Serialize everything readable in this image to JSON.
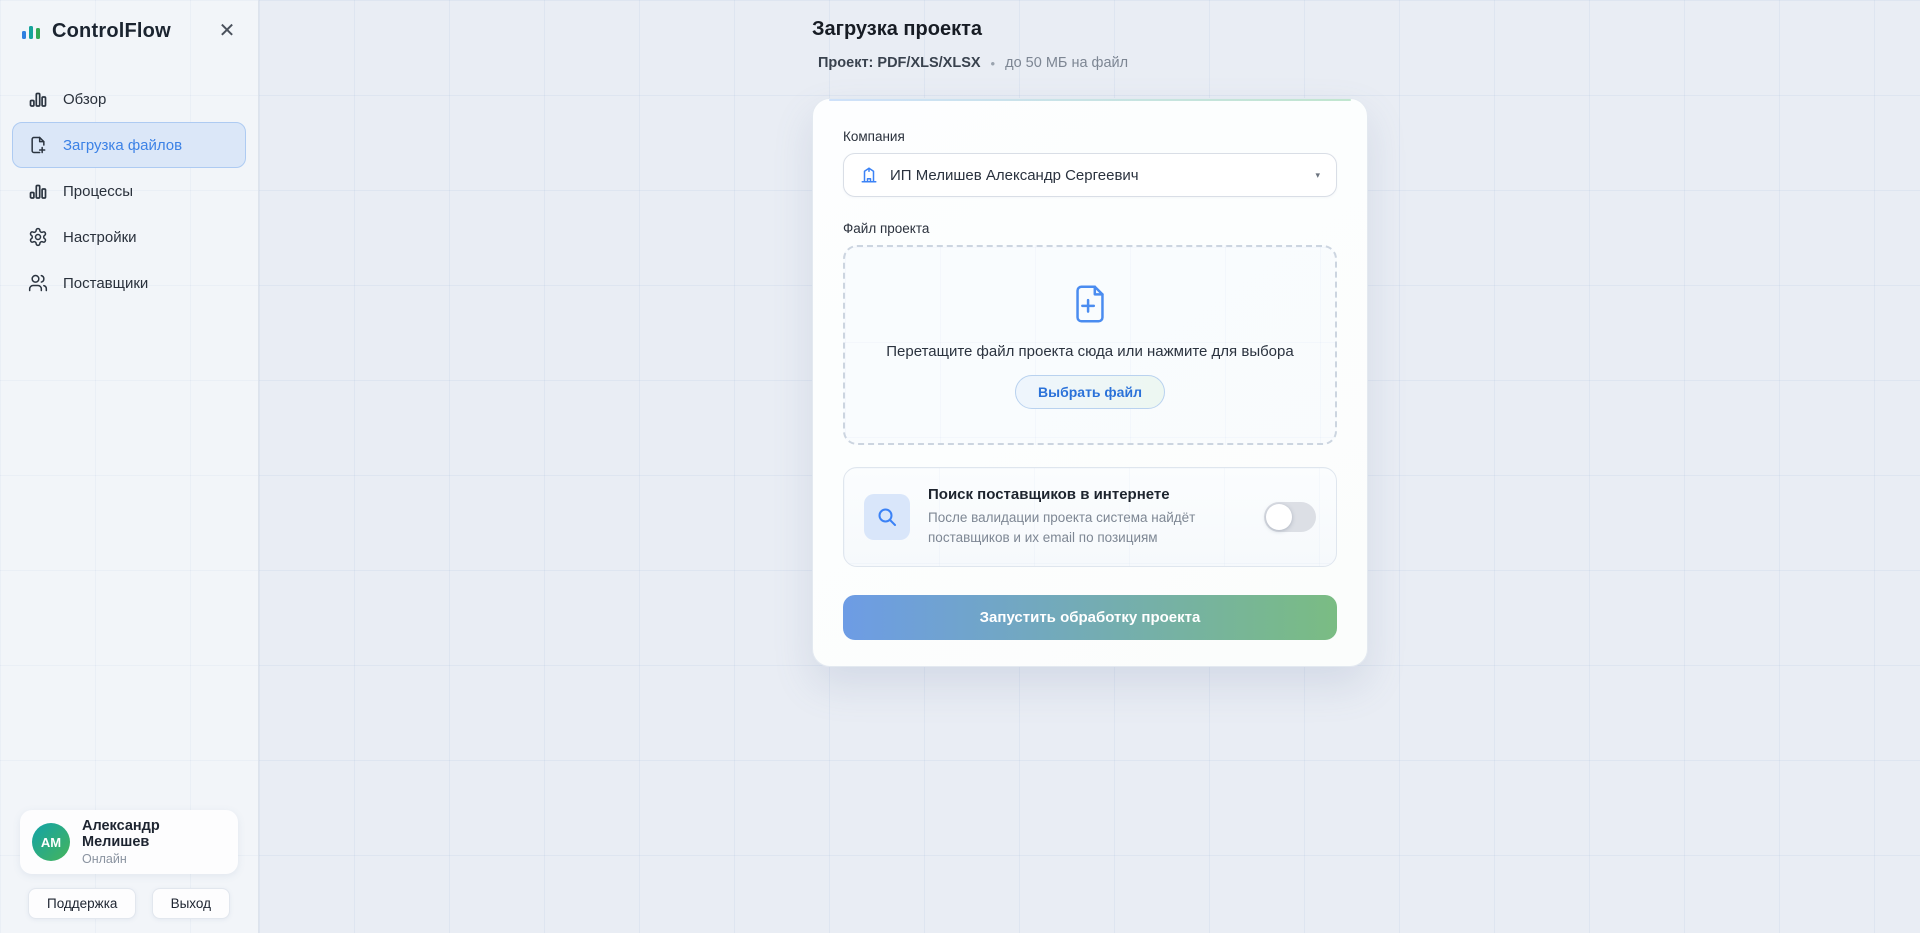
{
  "sidebar": {
    "brand": "ControlFlow",
    "items": [
      {
        "label": "Обзор",
        "icon": "bar-chart-icon",
        "active": false
      },
      {
        "label": "Загрузка файлов",
        "icon": "file-plus-icon",
        "active": true
      },
      {
        "label": "Процессы",
        "icon": "bar-chart-icon",
        "active": false
      },
      {
        "label": "Настройки",
        "icon": "gear-icon",
        "active": false
      },
      {
        "label": "Поставщики",
        "icon": "users-icon",
        "active": false
      }
    ],
    "user": {
      "initials": "АМ",
      "name": "Александр Мелишев",
      "status": "Онлайн"
    },
    "footer": {
      "support_label": "Поддержка",
      "logout_label": "Выход"
    }
  },
  "header": {
    "title": "Загрузка проекта",
    "project_label": "Проект: PDF/XLS/XLSX",
    "separator": "•",
    "limit_label": "до 50 МБ на файл"
  },
  "form": {
    "company": {
      "label": "Компания",
      "selected_value": "ИП Мелишев Александр Сергеевич"
    },
    "file": {
      "label": "Файл проекта",
      "dropzone_text": "Перетащите файл проекта сюда или нажмите для выбора",
      "choose_button_label": "Выбрать файл"
    },
    "search_toggle": {
      "title": "Поиск поставщиков в интернете",
      "description": "После валидации проекта система найдёт поставщиков и их email по позициям",
      "enabled": false
    },
    "submit_label": "Запустить обработку проекта"
  },
  "colors": {
    "accent_blue": "#3c82e6",
    "accent_green": "#46b45a",
    "selected_nav_bg": "#dbe7f8",
    "submit_gradient_start": "#6d9ce5",
    "submit_gradient_end": "#7abc83",
    "avatar_gradient_start": "#12a3a8",
    "avatar_gradient_end": "#46b45a",
    "main_bg": "#e9edf4",
    "sidebar_bg": "#f2f5f9"
  },
  "close_glyph": "✕"
}
